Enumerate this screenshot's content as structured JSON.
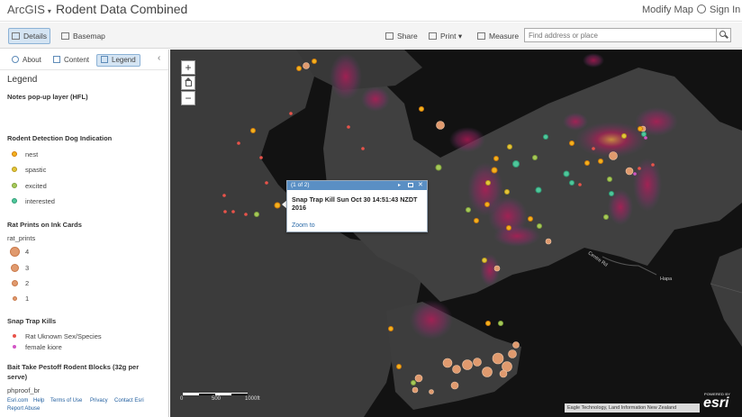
{
  "topbar": {
    "app_name": "ArcGIS",
    "app_chevron": "▾",
    "map_title": "Rodent Data Combined",
    "modify_map": "Modify Map",
    "sign_in": "Sign In"
  },
  "toolbar": {
    "details": "Details",
    "basemap": "Basemap",
    "share": "Share",
    "print": "Print",
    "print_chevron": "▾",
    "measure": "Measure",
    "search_placeholder": "Find address or place"
  },
  "sidebar": {
    "tabs": {
      "about": "About",
      "content": "Content",
      "legend": "Legend"
    },
    "collapse_glyph": "‹",
    "legend_heading": "Legend",
    "sections": [
      {
        "title": "Notes pop-up layer (HFL)"
      },
      {
        "title": "Rodent Detection Dog Indication",
        "items": [
          {
            "label": "nest",
            "color": "#f3b21e",
            "outline": "#d07a0a"
          },
          {
            "label": "spastic",
            "color": "#e2c53c",
            "outline": "#b89a18"
          },
          {
            "label": "excited",
            "color": "#a6c95a",
            "outline": "#7fa23a"
          },
          {
            "label": "interested",
            "color": "#4fc79b",
            "outline": "#2f9c75"
          }
        ]
      },
      {
        "title": "Rat Prints on Ink Cards",
        "field": "rat_prints",
        "items": [
          {
            "label": "4",
            "size": 4
          },
          {
            "label": "3",
            "size": 3
          },
          {
            "label": "2",
            "size": 2
          },
          {
            "label": "1",
            "size": 1
          }
        ]
      },
      {
        "title": "Snap Trap Kills",
        "items": [
          {
            "label": "Rat Uknown Sex/Species",
            "color": "#e8534a"
          },
          {
            "label": "female kiore",
            "color": "#d255c5"
          }
        ]
      },
      {
        "title": "Bait Take Pestoff Rodent Blocks (32g per serve)",
        "field": "phproof_br"
      }
    ],
    "footer": {
      "esri": "Esri.com",
      "help": "Help",
      "terms": "Terms of Use",
      "privacy": "Privacy",
      "contact": "Contact Esri",
      "report": "Report Abuse"
    }
  },
  "map": {
    "zoom_in": "+",
    "zoom_out": "−",
    "scale": {
      "zero": "0",
      "mid": "500",
      "max": "1000ft"
    },
    "attribution": "Eagle Technology, Land Information New Zealand",
    "esri_powered": "POWERED BY",
    "esri_logo": "esri",
    "labels": {
      "road": "Centre Rd",
      "place": "Hapa"
    },
    "popup": {
      "counter": "(1 of 2)",
      "next_glyph": "▸",
      "close_glyph": "✕",
      "title": "Snap Trap Kill Sun Oct 30 14:51:43 NZDT 2016",
      "zoom_link": "Zoom to"
    }
  },
  "colors": {
    "accent": "#5a8fc4",
    "tab_active": "#d4e4f3",
    "map_background": "#121212",
    "land": "#3a3a3a",
    "ink_card": "#e09a6e"
  }
}
